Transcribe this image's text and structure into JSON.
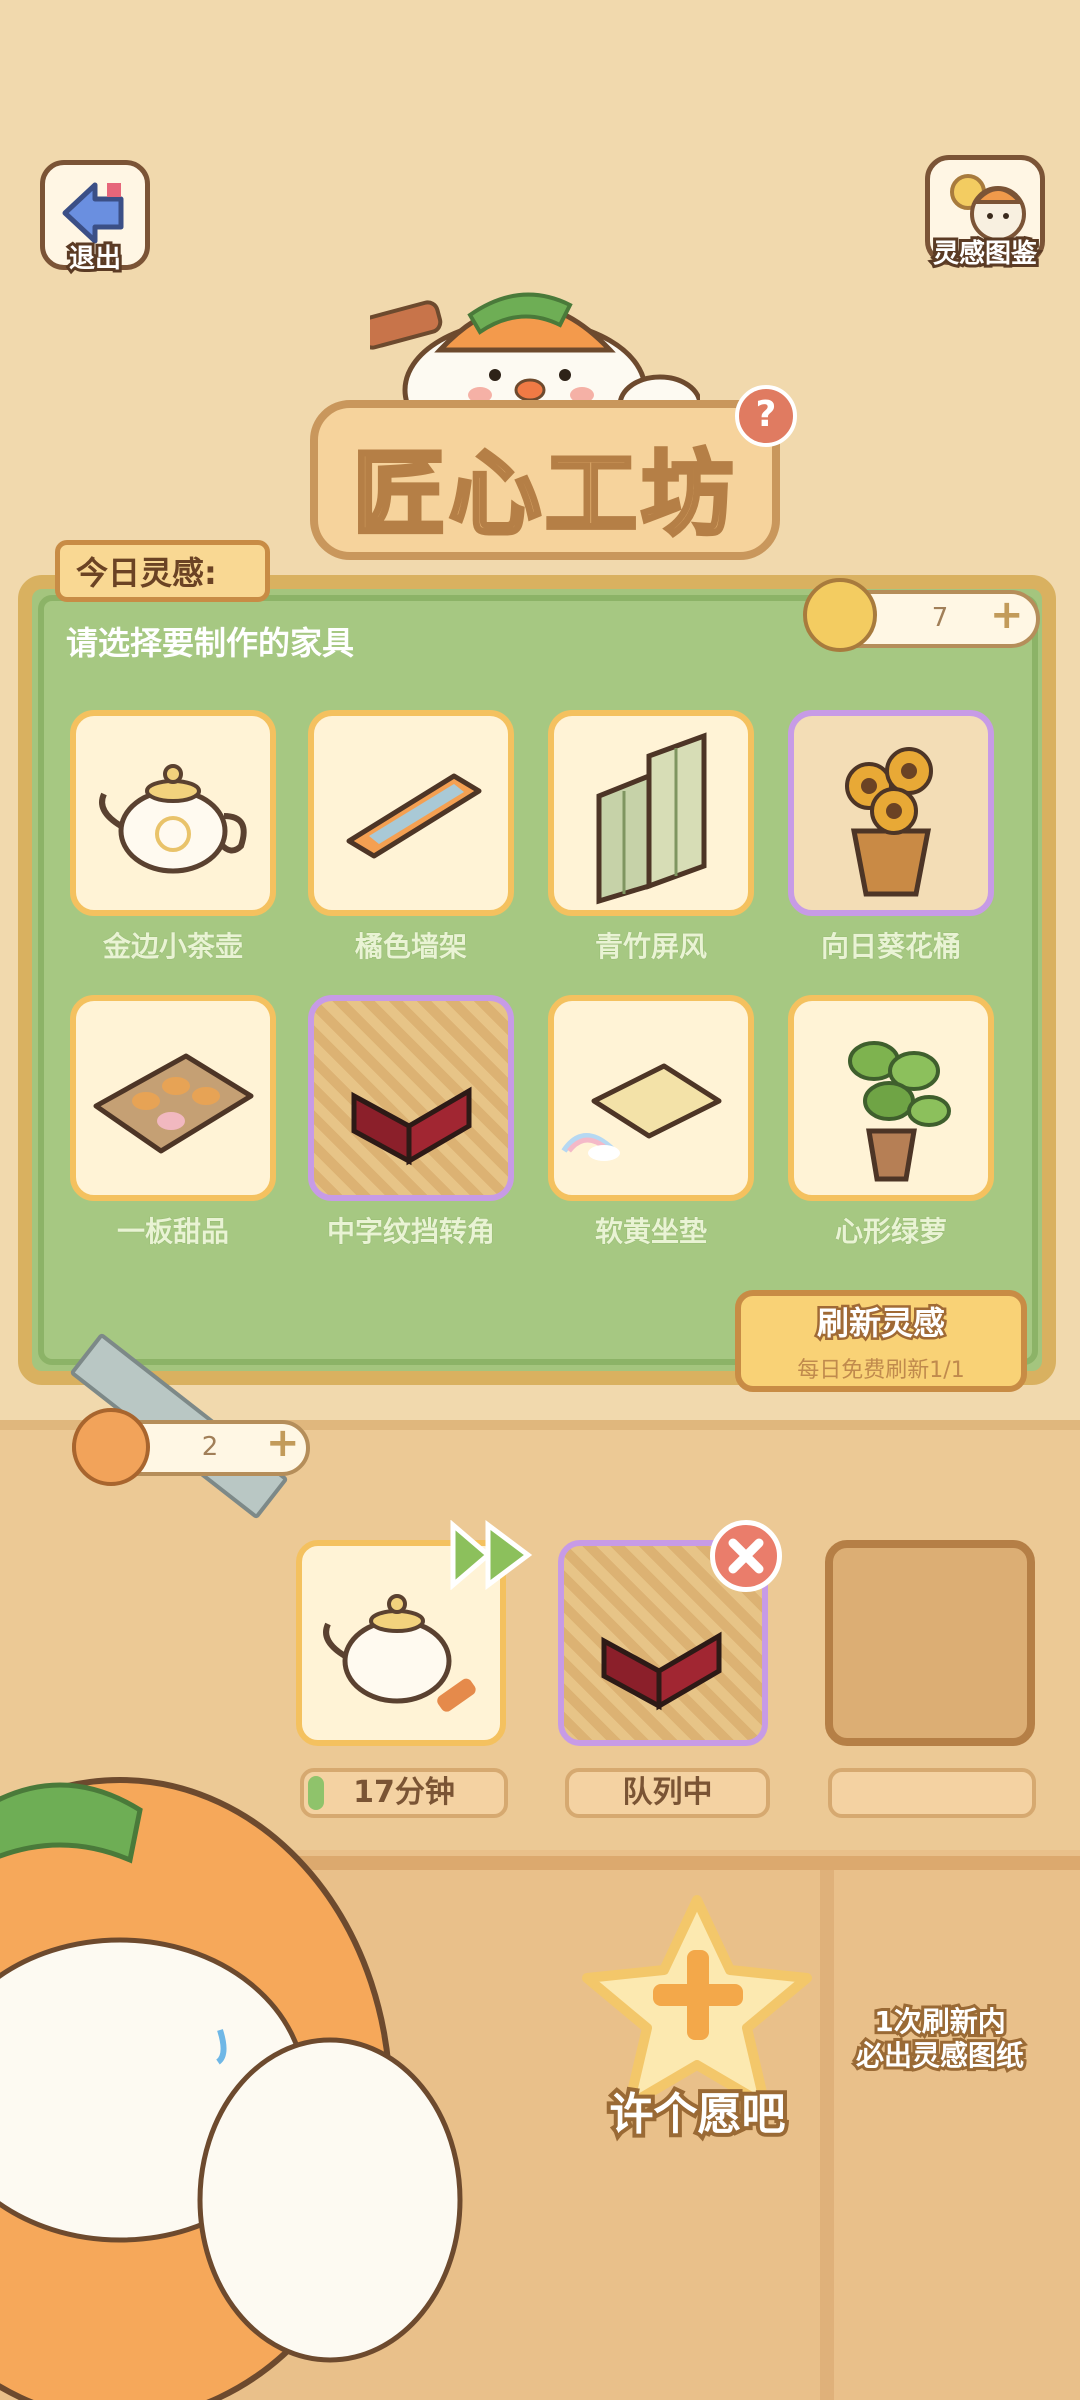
{
  "header": {
    "exit_label": "退出",
    "codex_label": "灵感图鉴",
    "title": "匠心工坊",
    "help_icon": "?"
  },
  "panel": {
    "today_tag": "今日灵感:",
    "instruction": "请选择要制作的家具",
    "ticket_count": "7",
    "plus": "+",
    "items": [
      {
        "label": "金边小茶壶",
        "icon": "teapot-icon"
      },
      {
        "label": "橘色墙架",
        "icon": "wall-shelf-icon"
      },
      {
        "label": "青竹屏风",
        "icon": "bamboo-screen-icon"
      },
      {
        "label": "向日葵花桶",
        "icon": "sunflower-bucket-icon"
      },
      {
        "label": "一板甜品",
        "icon": "dessert-tray-icon"
      },
      {
        "label": "中字纹挡转角",
        "icon": "corner-fence-icon"
      },
      {
        "label": "软黄坐垫",
        "icon": "cushion-icon"
      },
      {
        "label": "心形绿萝",
        "icon": "pothos-plant-icon"
      }
    ],
    "refresh": {
      "label": "刷新灵感",
      "sub": "每日免费刷新1/1"
    }
  },
  "workbench": {
    "pumpkin_count": "2",
    "plus": "+",
    "slots": [
      {
        "status": "17分钟",
        "item": "teapot-icon"
      },
      {
        "status": "队列中",
        "item": "corner-fence-icon"
      },
      {
        "status": "",
        "item": "empty"
      }
    ]
  },
  "wish": {
    "label": "许个愿吧",
    "hint_line1": "1次刷新内",
    "hint_line2": "必出灵感图纸"
  },
  "colors": {
    "panel_green": "#a4c57e",
    "card_border": "#f4c15f",
    "rare_border": "#c79be6",
    "accent_red": "#ea7d6b"
  }
}
